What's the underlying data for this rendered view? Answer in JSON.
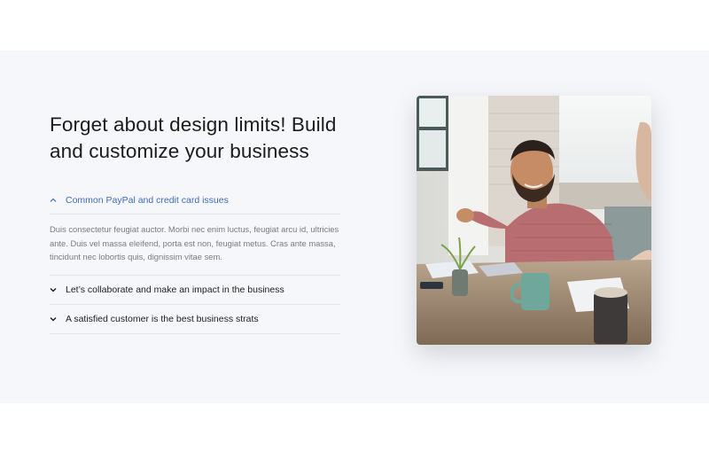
{
  "section": {
    "heading": "Forget about design limits! Build and customize your business",
    "accordion": [
      {
        "title": "Common PayPal and credit card issues",
        "expanded": true,
        "body": "Duis consectetur feugiat auctor. Morbi nec enim luctus, feugiat arcu id, ultricies ante. Duis vel massa eleifend, porta est non, feugiat metus. Cras ante massa, tincidunt nec lobortis quis, dignissim vitae sem."
      },
      {
        "title": "Let’s collaborate and make an impact in the business",
        "expanded": false
      },
      {
        "title": "A satisfied customer is the best business strats",
        "expanded": false
      }
    ],
    "image": {
      "subject": "business-meeting-photo"
    }
  },
  "colors": {
    "section_bg": "#f6f7fa",
    "accent": "#3f6bbd",
    "divider": "#e2e4ea",
    "body_text": "#777b84"
  }
}
